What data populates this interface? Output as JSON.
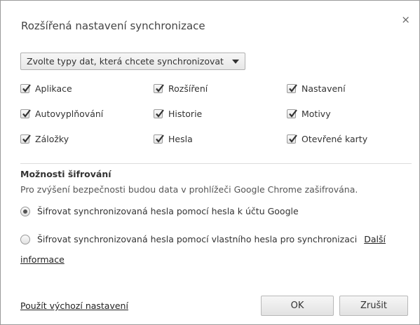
{
  "dialog": {
    "title": "Rozšířená nastavení synchronizace",
    "close_label": "×"
  },
  "sync_select": {
    "selected": "Zvolte typy dat, která chcete synchronizovat"
  },
  "data_types": [
    {
      "label": "Aplikace",
      "checked": true
    },
    {
      "label": "Rozšíření",
      "checked": true
    },
    {
      "label": "Nastavení",
      "checked": true
    },
    {
      "label": "Autovyplňování",
      "checked": true
    },
    {
      "label": "Historie",
      "checked": true
    },
    {
      "label": "Motivy",
      "checked": true
    },
    {
      "label": "Záložky",
      "checked": true
    },
    {
      "label": "Hesla",
      "checked": true
    },
    {
      "label": "Otevřené karty",
      "checked": true
    }
  ],
  "encryption": {
    "title": "Možnosti šifrování",
    "description": "Pro zvýšení bezpečnosti budou data v prohlížeči Google Chrome zašifrována.",
    "option_google": "Šifrovat synchronizovaná hesla pomocí hesla k účtu Google",
    "option_custom": "Šifrovat synchronizovaná hesla pomocí vlastního hesla pro synchronizaci",
    "more_link_part1": "Další",
    "more_link_part2": "informace",
    "selected_option": "google"
  },
  "footer": {
    "reset_link": "Použít výchozí nastavení",
    "ok_label": "OK",
    "cancel_label": "Zrušit"
  }
}
